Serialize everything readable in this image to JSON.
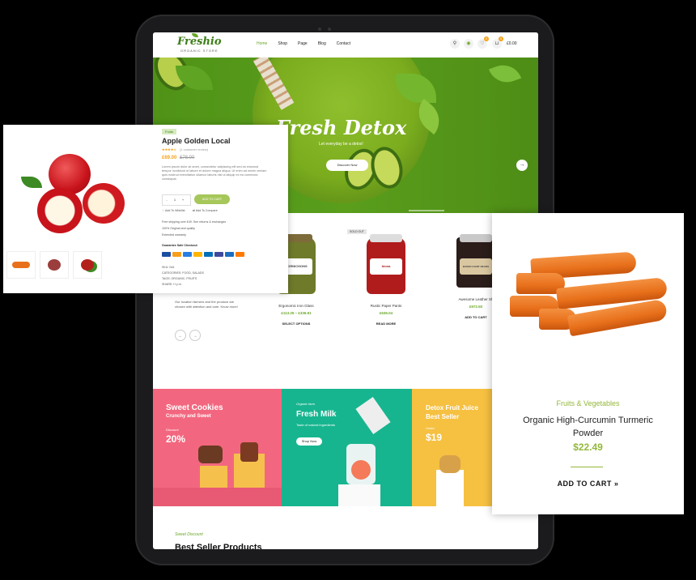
{
  "header": {
    "logo": "Freshio",
    "logo_sub": "ORGANIC STORE",
    "nav": [
      "Home",
      "Shop",
      "Page",
      "Blog",
      "Contact"
    ],
    "cart_count": "0",
    "wish_count": "0",
    "cart_amount": "£0.00"
  },
  "hero": {
    "title": "Fresh Detox",
    "subtitle": "Let everyday be a detox!",
    "button": "Discover Now",
    "arrow": "→"
  },
  "products_section": {
    "desc": "Our location farmers and the produce are chosen with attention and care. Know more!",
    "prev": "←",
    "next": "→",
    "sold_tag": "SOLD OUT",
    "items": [
      {
        "label": "CORNICHONS",
        "name": "Ergonomic Iron Glass",
        "price": "£113.25 – £336.91",
        "action": "SELECT OPTIONS"
      },
      {
        "label": "biona",
        "name": "Rustic Paper Pants",
        "price": "£636.04",
        "action": "READ MORE"
      },
      {
        "label": "BAKED GIANT BEANS",
        "name": "Awesome Leather Sh",
        "price": "£972.50",
        "action": "ADD TO CART"
      }
    ]
  },
  "banners": [
    {
      "title": "Sweet Cookies",
      "sub": "Crunchy and Sweet",
      "small": "Discount",
      "big": "20%",
      "color": "#f2677f"
    },
    {
      "title": "Fresh Milk",
      "kicker": "Organic farm",
      "small": "Taste of natural ingredients",
      "button": "Shop Now",
      "color": "#17b58f"
    },
    {
      "title": "Detox Fruit Juice",
      "sub": "Best Seller",
      "small": "Under",
      "big": "$19",
      "color": "#f6c041"
    }
  ],
  "bottom": {
    "kicker": "Sweet Discount",
    "title": "Best Seller Products"
  },
  "quick_view": {
    "tag": "Fruits",
    "title": "Apple Golden Local",
    "stars": "★★★★☆",
    "reviews": "(1 customer review)",
    "price_new": "£69.00",
    "price_old": "£78.00",
    "description": "Lorem ipsum dolor sit amet, consectetur adipiscing elit sed do eiusmod tempor incididunt ut labore et dolore magna aliqua. Ut enim ad minim veniam quis nostrud exercitation ullamco laboris nisi ut aliquip ex ea commodo consequat.",
    "qty": "1",
    "minus": "-",
    "plus": "+",
    "add_to_cart": "ADD TO CART",
    "wishlist": "Add To Wishlist",
    "compare": "Add To Compare",
    "features": [
      "Free shipping over £49. See returns & exchanges",
      "100% Original and quality",
      "Extended warranty"
    ],
    "guarantee": "Guarantee Safe Checkout",
    "sku": "SKU: N/A",
    "categories": "CATEGORIES: FOOD, SALADS",
    "tags": "TAGS: ORGANIC, FRUITS",
    "share": "SHARE:"
  },
  "product_card": {
    "category": "Fruits & Vegetables",
    "title": "Organic High-Curcumin Turmeric Powder",
    "price": "$22.49",
    "add_to_cart": "ADD TO CART",
    "arrow": "»"
  }
}
